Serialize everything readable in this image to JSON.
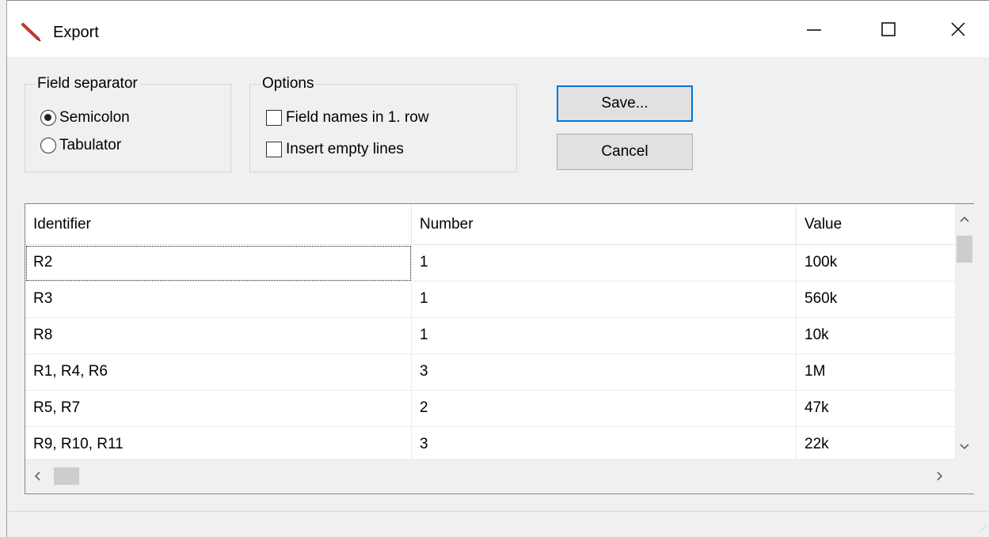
{
  "window": {
    "title": "Export",
    "app_icon": "pencil-icon",
    "caption": {
      "minimize": "—",
      "maximize": "☐",
      "close": "✕"
    }
  },
  "field_separator": {
    "legend": "Field separator",
    "options": [
      {
        "label": "Semicolon",
        "selected": true
      },
      {
        "label": "Tabulator",
        "selected": false
      }
    ]
  },
  "options": {
    "legend": "Options",
    "items": [
      {
        "label": "Field names in 1. row",
        "checked": false
      },
      {
        "label": "Insert empty lines",
        "checked": false
      }
    ]
  },
  "buttons": {
    "save": "Save...",
    "cancel": "Cancel"
  },
  "table": {
    "columns": [
      "Identifier",
      "Number",
      "Value"
    ],
    "rows": [
      [
        "R2",
        "1",
        "100k"
      ],
      [
        "R3",
        "1",
        "560k"
      ],
      [
        "R8",
        "1",
        "10k"
      ],
      [
        "R1, R4, R6",
        "3",
        "1M"
      ],
      [
        "R5, R7",
        "2",
        "47k"
      ],
      [
        "R9, R10, R11",
        "3",
        "22k"
      ]
    ]
  },
  "scrollbars": {
    "up": "⌃",
    "down": "⌄",
    "left": "<",
    "right": ">"
  },
  "colors": {
    "focus_accent": "#0078d7",
    "icon_red": "#c0392b"
  }
}
